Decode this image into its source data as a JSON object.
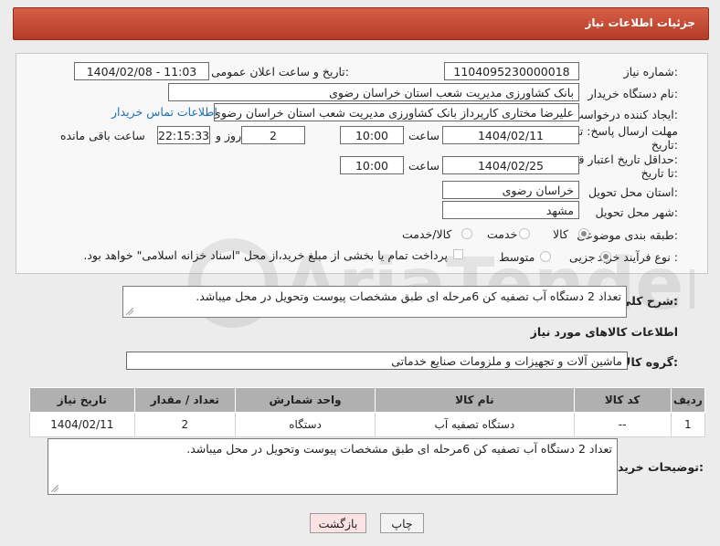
{
  "header": {
    "title": "جزئیات اطلاعات نیاز"
  },
  "form": {
    "need_number_label": "شماره نیاز:",
    "need_number": "1104095230000018",
    "announce_label": "تاریخ و ساعت اعلان عمومی:",
    "announce_value": "1404/02/08 - 11:03",
    "buyer_org_label": "نام دستگاه خریدار:",
    "buyer_org": "بانک کشاورزی مدیریت شعب استان خراسان رضوی",
    "creator_label": "ایجاد کننده درخواست:",
    "creator": "علیرضا مختاری کارپرداز بانک کشاورزی مدیریت شعب استان خراسان رضوی",
    "contact_link": "اطلاعات تماس خریدار",
    "deadline_label_1": "مهلت ارسال پاسخ: تا",
    "deadline_label_2": "تاریخ:",
    "deadline_date": "1404/02/11",
    "hour_label": "ساعت",
    "deadline_time": "10:00",
    "days": "2",
    "days_label": "روز و",
    "remaining_time": "22:15:33",
    "remaining_label": "ساعت باقی مانده",
    "validity_label_1": "حداقل تاریخ اعتبار قیمت:",
    "validity_label_2": "تا تاریخ:",
    "validity_date": "1404/02/25",
    "validity_time": "10:00",
    "province_label": "استان محل تحویل:",
    "province": "خراسان رضوی",
    "city_label": "شهر محل تحویل:",
    "city": "مشهد",
    "category_label": "طبقه بندی موضوعی:",
    "category_options": [
      "کالا",
      "خدمت",
      "کالا/خدمت"
    ],
    "process_label": "نوع فرآیند خرید :",
    "process_options": [
      "جزیی",
      "متوسط"
    ],
    "payment_note": "پرداخت تمام یا بخشی از مبلغ خرید،از محل \"اسناد خزانه اسلامی\" خواهد بود."
  },
  "description": {
    "label": "شرح کلی نیاز:",
    "text": "تعداد 2 دستگاه آب تصفیه کن 6مرحله ای طبق مشخصات پیوست  وتحویل در محل میباشد."
  },
  "goods": {
    "section_title": "اطلاعات کالاهای مورد نیاز",
    "group_label": "گروه کالا:",
    "group_value": "ماشین آلات و تجهیزات و ملزومات صنایع خدماتی",
    "columns": [
      "ردیف",
      "کد کالا",
      "نام کالا",
      "واحد شمارش",
      "تعداد / مقدار",
      "تاریخ نیاز"
    ],
    "rows": [
      [
        "1",
        "--",
        "دستگاه تصفیه آب",
        "دستگاه",
        "2",
        "1404/02/11"
      ]
    ]
  },
  "buyer_notes": {
    "label": "توضیحات خریدار:",
    "text": "تعداد 2 دستگاه آب تصفیه کن 6مرحله ای طبق مشخصات پیوست  وتحویل در محل میباشد."
  },
  "buttons": {
    "print": "چاپ",
    "back": "بازگشت"
  },
  "watermark": {
    "brand": "AriaTender.neT"
  },
  "colors": {
    "header": "#c94a33",
    "link": "#1c6fb5",
    "back_button_bg": "#fbe3e3"
  }
}
